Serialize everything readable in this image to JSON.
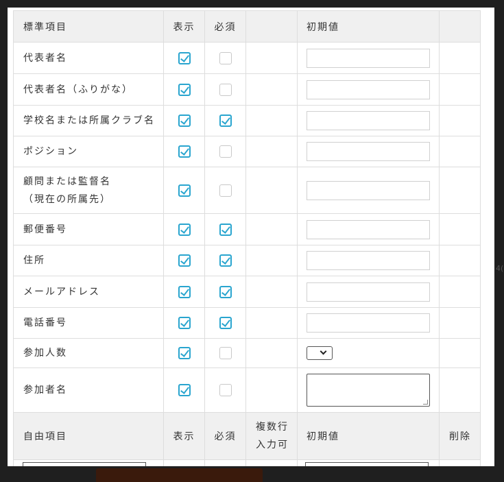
{
  "standard_header": {
    "item": "標準項目",
    "display": "表示",
    "required": "必須",
    "multiline": "",
    "initial": "初期値",
    "delete": ""
  },
  "standard_rows": [
    {
      "label": "代表者名",
      "label2": "",
      "display": true,
      "required": false,
      "field": "text"
    },
    {
      "label": "代表者名（ふりがな）",
      "label2": "",
      "display": true,
      "required": false,
      "field": "text"
    },
    {
      "label": "学校名または所属クラブ名",
      "label2": "",
      "display": true,
      "required": true,
      "field": "text"
    },
    {
      "label": "ポジション",
      "label2": "",
      "display": true,
      "required": false,
      "field": "text"
    },
    {
      "label": "顧問または監督名",
      "label2": "（現在の所属先）",
      "display": true,
      "required": false,
      "field": "text"
    },
    {
      "label": "郵便番号",
      "label2": "",
      "display": true,
      "required": true,
      "field": "text"
    },
    {
      "label": "住所",
      "label2": "",
      "display": true,
      "required": true,
      "field": "text"
    },
    {
      "label": "メールアドレス",
      "label2": "",
      "display": true,
      "required": true,
      "field": "text"
    },
    {
      "label": "電話番号",
      "label2": "",
      "display": true,
      "required": true,
      "field": "text"
    },
    {
      "label": "参加人数",
      "label2": "",
      "display": true,
      "required": false,
      "field": "select"
    },
    {
      "label": "参加者名",
      "label2": "",
      "display": true,
      "required": false,
      "field": "textarea"
    }
  ],
  "free_header": {
    "item": "自由項目",
    "display": "表示",
    "required": "必須",
    "multiline_1": "複数行",
    "multiline_2": "入力可",
    "initial": "初期値",
    "delete": "削除"
  },
  "side_hint": "4(",
  "colors": {
    "accent": "#29a5cf",
    "header_bg": "#f0f0f0",
    "backdrop": "#1f1f1f"
  }
}
